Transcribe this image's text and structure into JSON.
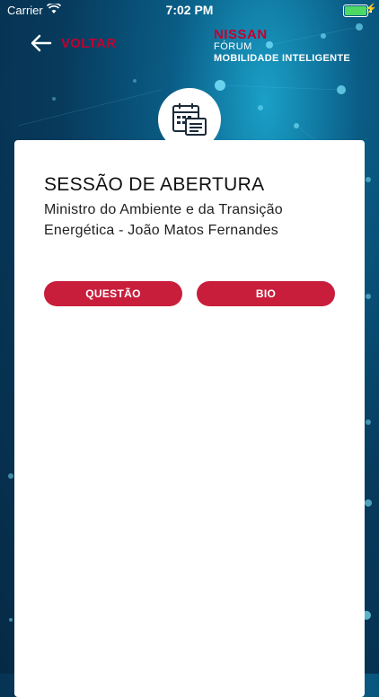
{
  "status_bar": {
    "carrier": "Carrier",
    "time": "7:02 PM"
  },
  "header": {
    "back_label": "VOLTAR",
    "brand_name": "NISSAN",
    "brand_forum": "FÓRUM",
    "brand_subtitle": "MOBILIDADE INTELIGENTE"
  },
  "session": {
    "title": "SESSÃO DE ABERTURA",
    "subtitle": "Ministro do Ambiente e da Transição Energética - João Matos Fernandes",
    "icon": "calendar-icon"
  },
  "actions": {
    "questao_label": "QUESTÃO",
    "bio_label": "BIO"
  },
  "colors": {
    "accent": "#c81e3c",
    "brand_red": "#c3002f",
    "background": "#073a5c"
  }
}
